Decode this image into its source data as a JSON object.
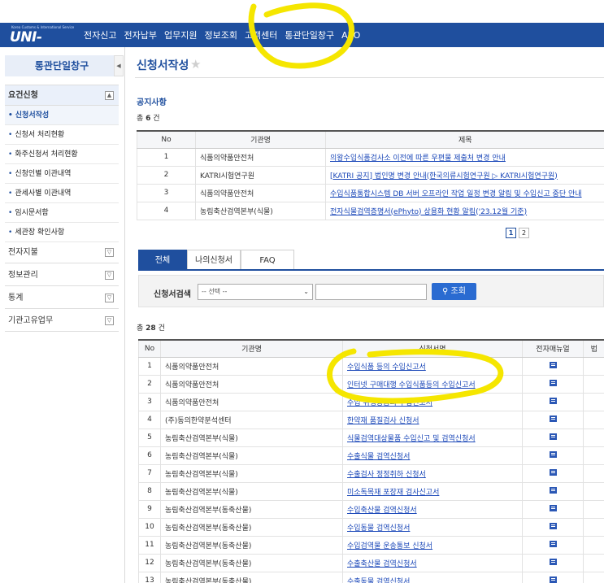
{
  "brand": {
    "tagline": "Korea Customs & International Service",
    "logo_text": "UNI-PASS"
  },
  "nav": [
    "전자신고",
    "전자납부",
    "업무지원",
    "정보조회",
    "고객센터",
    "통관단일창구",
    "AEO"
  ],
  "sidebar": {
    "title": "통관단일창구",
    "collapse_icon": "◀",
    "active_section": "요건신청",
    "items": [
      {
        "label": "신청서작성",
        "current": true
      },
      {
        "label": "신청서 처리현황"
      },
      {
        "label": "화주신청서 처리현황"
      },
      {
        "label": "신청인별 이관내역"
      },
      {
        "label": "관세사별 이관내역"
      },
      {
        "label": "임시문서함"
      },
      {
        "label": "세관장 확인사항"
      }
    ],
    "sections": [
      "전자지불",
      "정보관리",
      "통계",
      "기관고유업무"
    ]
  },
  "page": {
    "title": "신청서작성",
    "star": "★"
  },
  "notice": {
    "heading": "공지사항",
    "count_prefix": "총",
    "count": "6",
    "count_suffix": "건",
    "columns": [
      "No",
      "기관명",
      "제목"
    ],
    "rows": [
      {
        "no": "1",
        "org": "식품의약품안전처",
        "title": "의왕수입식품검사소 이전에 따른 우편물 제출처 변경 안내"
      },
      {
        "no": "2",
        "org": "KATRI시험연구원",
        "title": "[KATRI 공지] 법인명 변경 안내(한국의류시험연구원 ▷ KATRI시험연구원)"
      },
      {
        "no": "3",
        "org": "식품의약품안전처",
        "title": "수입식품통합시스템 DB 서버 오프라인 작업 일정 변경 알림 및 수입신고 중단 안내"
      },
      {
        "no": "4",
        "org": "농림축산검역본부(식물)",
        "title": "전자식물검역증명서(ePhyto) 상용화 현황 알림('23.12월 기준)"
      }
    ],
    "pages": [
      "1",
      "2"
    ]
  },
  "tabs": [
    "전체",
    "나의신청서",
    "FAQ"
  ],
  "search": {
    "label": "신청서검색",
    "select_value": "-- 선택 --",
    "button": "조회"
  },
  "list": {
    "count_prefix": "총",
    "count": "28",
    "count_suffix": "건",
    "columns": [
      "No",
      "기관명",
      "신청서명",
      "전자매뉴얼",
      "법"
    ],
    "rows": [
      {
        "no": "1",
        "org": "식품의약품안전처",
        "name": "수입식품 등의 수입신고서"
      },
      {
        "no": "2",
        "org": "식품의약품안전처",
        "name": "인터넷 구매대행 수입식품등의 수입신고서"
      },
      {
        "no": "3",
        "org": "식품의약품안전처",
        "name": "수입 위생용품의 수입신고서"
      },
      {
        "no": "4",
        "org": "(주)동의한약분석센터",
        "name": "한약재 품질검사 신청서"
      },
      {
        "no": "5",
        "org": "농림축산검역본부(식물)",
        "name": "식물검역대상물품 수입신고 및 검역신청서"
      },
      {
        "no": "6",
        "org": "농림축산검역본부(식물)",
        "name": "수출식물 검역신청서"
      },
      {
        "no": "7",
        "org": "농림축산검역본부(식물)",
        "name": "수출검사 정정취하 신청서"
      },
      {
        "no": "8",
        "org": "농림축산검역본부(식물)",
        "name": "미소독목재 포장재 검사신고서"
      },
      {
        "no": "9",
        "org": "농림축산검역본부(동축산물)",
        "name": "수입축산물 검역신청서"
      },
      {
        "no": "10",
        "org": "농림축산검역본부(동축산물)",
        "name": "수입동물 검역신청서"
      },
      {
        "no": "11",
        "org": "농림축산검역본부(동축산물)",
        "name": "수입검역물 운송통보 신청서"
      },
      {
        "no": "12",
        "org": "농림축산검역본부(동축산물)",
        "name": "수출축산물 검역신청서"
      },
      {
        "no": "13",
        "org": "농림축산검역본부(동축산물)",
        "name": "수출동물 검역신청서"
      }
    ]
  },
  "colors": {
    "brand_blue": "#1f4f9e",
    "link_blue": "#1a47b8",
    "highlight": "#f5e600"
  }
}
